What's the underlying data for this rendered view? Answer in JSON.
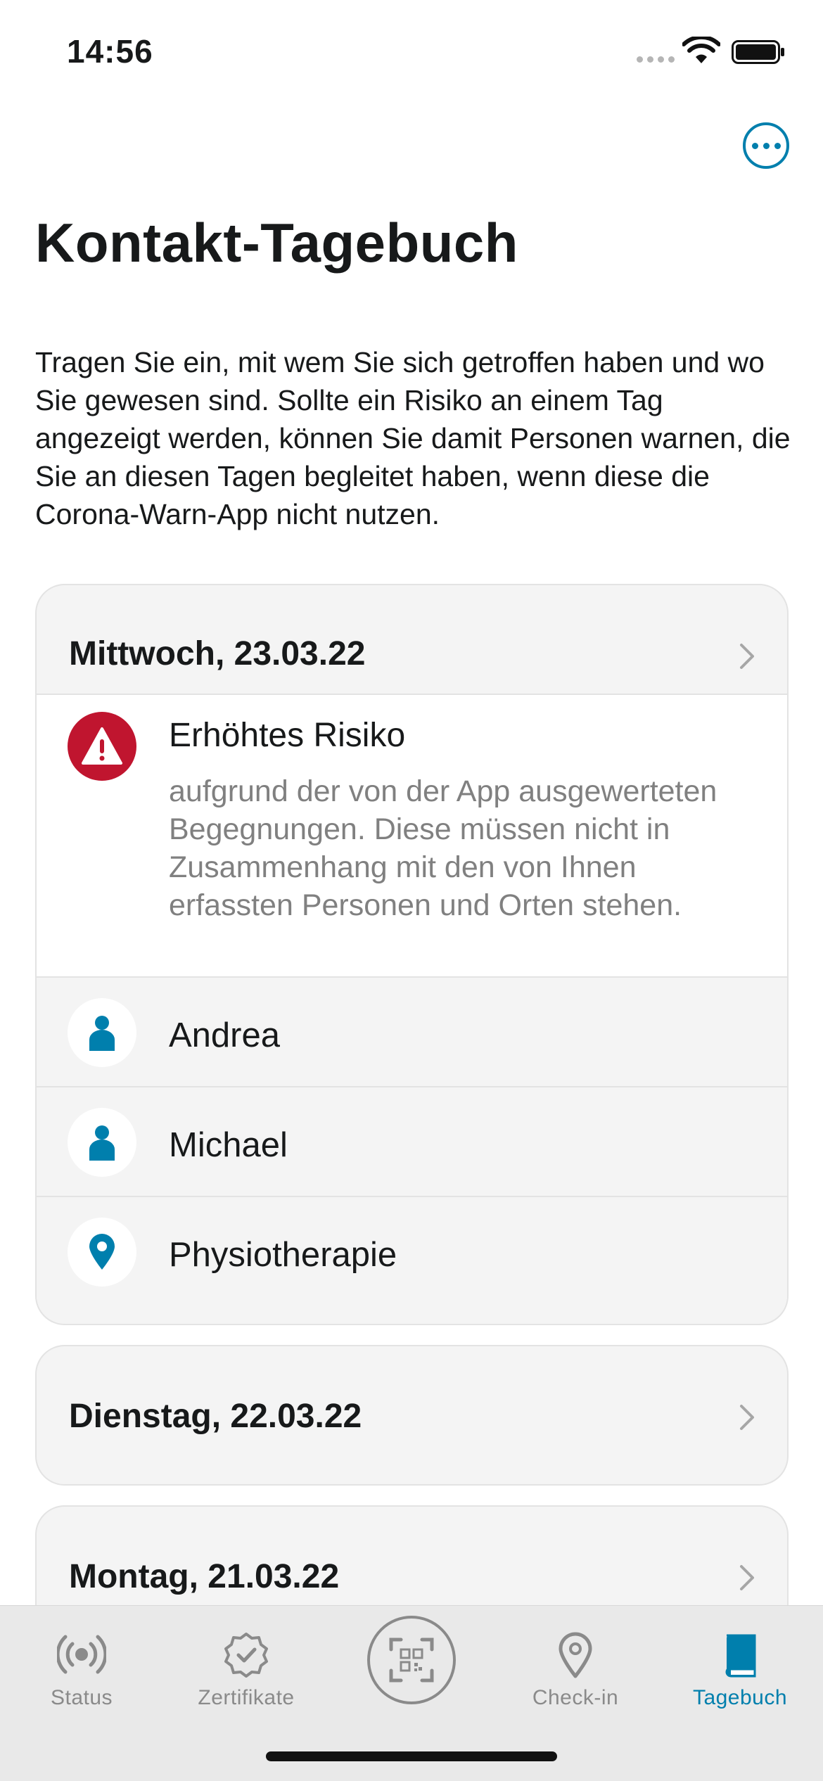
{
  "status_bar": {
    "time": "14:56"
  },
  "header": {
    "title": "Kontakt-Tagebuch",
    "intro": "Tragen Sie ein, mit wem Sie sich getroffen haben und wo Sie gewesen sind. Sollte ein Risiko an einem Tag angezeigt werden, können Sie damit Personen warnen, die Sie an diesen Tagen begleitet haben, wenn diese die Corona-Warn-App nicht nutzen."
  },
  "days": [
    {
      "date": "Mittwoch, 23.03.22",
      "risk": {
        "title": "Erhöhtes Risiko",
        "description": "aufgrund der von der App ausgewerteten Begegnungen. Diese müssen nicht in Zusammenhang mit den von Ihnen erfassten Personen und Orten stehen."
      },
      "entries": [
        {
          "label": "Andrea",
          "icon": "person-icon"
        },
        {
          "label": "Michael",
          "icon": "person-icon"
        },
        {
          "label": "Physiotherapie",
          "icon": "location-pin-icon"
        }
      ]
    },
    {
      "date": "Dienstag, 22.03.22"
    },
    {
      "date": "Montag, 21.03.22"
    }
  ],
  "tab_bar": {
    "tabs": [
      {
        "label": "Status",
        "icon": "status-broadcast-icon"
      },
      {
        "label": "Zertifikate",
        "icon": "certificate-icon"
      },
      {
        "label": "",
        "icon": "qr-scan-icon"
      },
      {
        "label": "Check-in",
        "icon": "location-pin-icon"
      },
      {
        "label": "Tagebuch",
        "icon": "book-icon"
      }
    ],
    "active": "Tagebuch"
  },
  "colors": {
    "accent": "#007fad",
    "risk": "#c0152f",
    "card_bg": "#f4f4f4",
    "muted_text": "#808080"
  }
}
